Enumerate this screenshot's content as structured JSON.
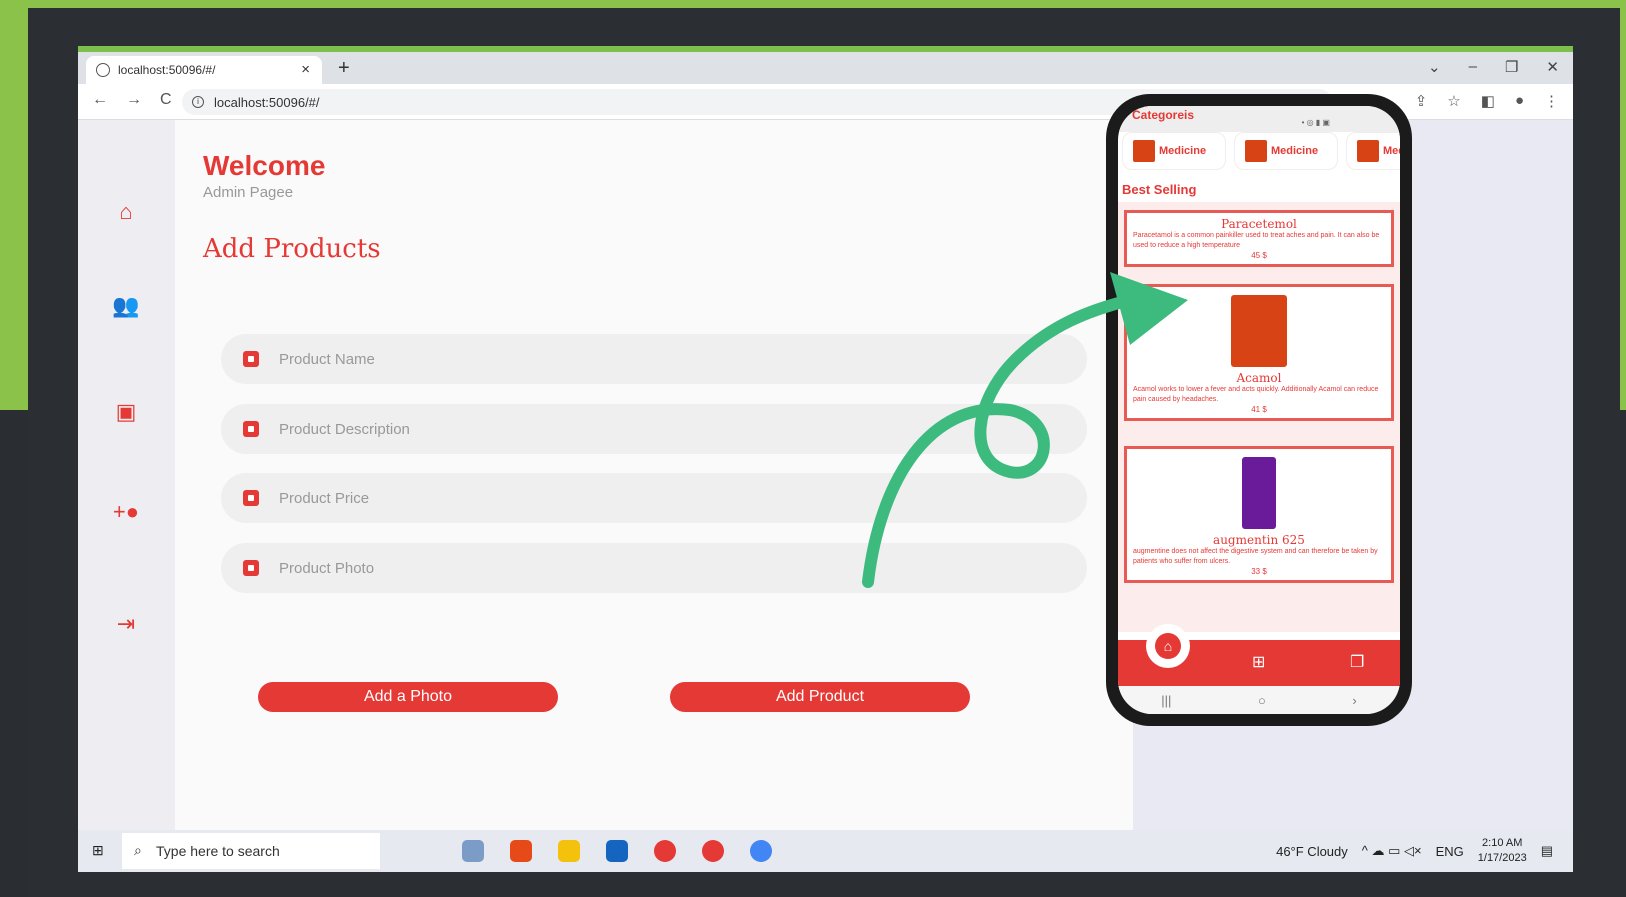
{
  "browser": {
    "tab_title": "localhost:50096/#/",
    "url": "localhost:50096/#/"
  },
  "admin": {
    "welcome": "Welcome",
    "subtitle": "Admin Pagee",
    "section_title": "Add Products",
    "fields": {
      "name_placeholder": "Product Name",
      "description_placeholder": "Product Description",
      "price_placeholder": "Product Price",
      "photo_placeholder": "Product Photo"
    },
    "add_photo_label": "Add a Photo",
    "add_product_label": "Add Product"
  },
  "sidebar": {
    "icons": [
      "home-icon",
      "group-icon",
      "medicine-bottle-icon",
      "add-person-icon",
      "logout-icon"
    ]
  },
  "phone": {
    "categories_title": "Categoreis",
    "chips": [
      "Medicine",
      "Medicine",
      "Med"
    ],
    "best_selling": "Best Selling",
    "products": [
      {
        "name": "Paracetemol",
        "description": "Paracetamol is a common painkiller used to treat aches and pain. It can also be used to reduce a high temperature",
        "price": "45 $"
      },
      {
        "name": "Acamol",
        "description": "Acamol works to lower a fever and acts quickly. Additionally Acamol can reduce pain caused by headaches.",
        "price": "41 $"
      },
      {
        "name": "augmentin 625",
        "description": "augmentine does not affect the digestive system and can therefore be taken by patients who suffer from ulcers.",
        "price": "33 $"
      }
    ]
  },
  "taskbar": {
    "search_placeholder": "Type here to search",
    "weather": "46°F Cloudy",
    "language": "ENG",
    "time": "2:10 AM",
    "date": "1/17/2023"
  },
  "colors": {
    "accent": "#e53935",
    "green_frame": "#8bc34a",
    "arrow": "#3dbb7e"
  }
}
